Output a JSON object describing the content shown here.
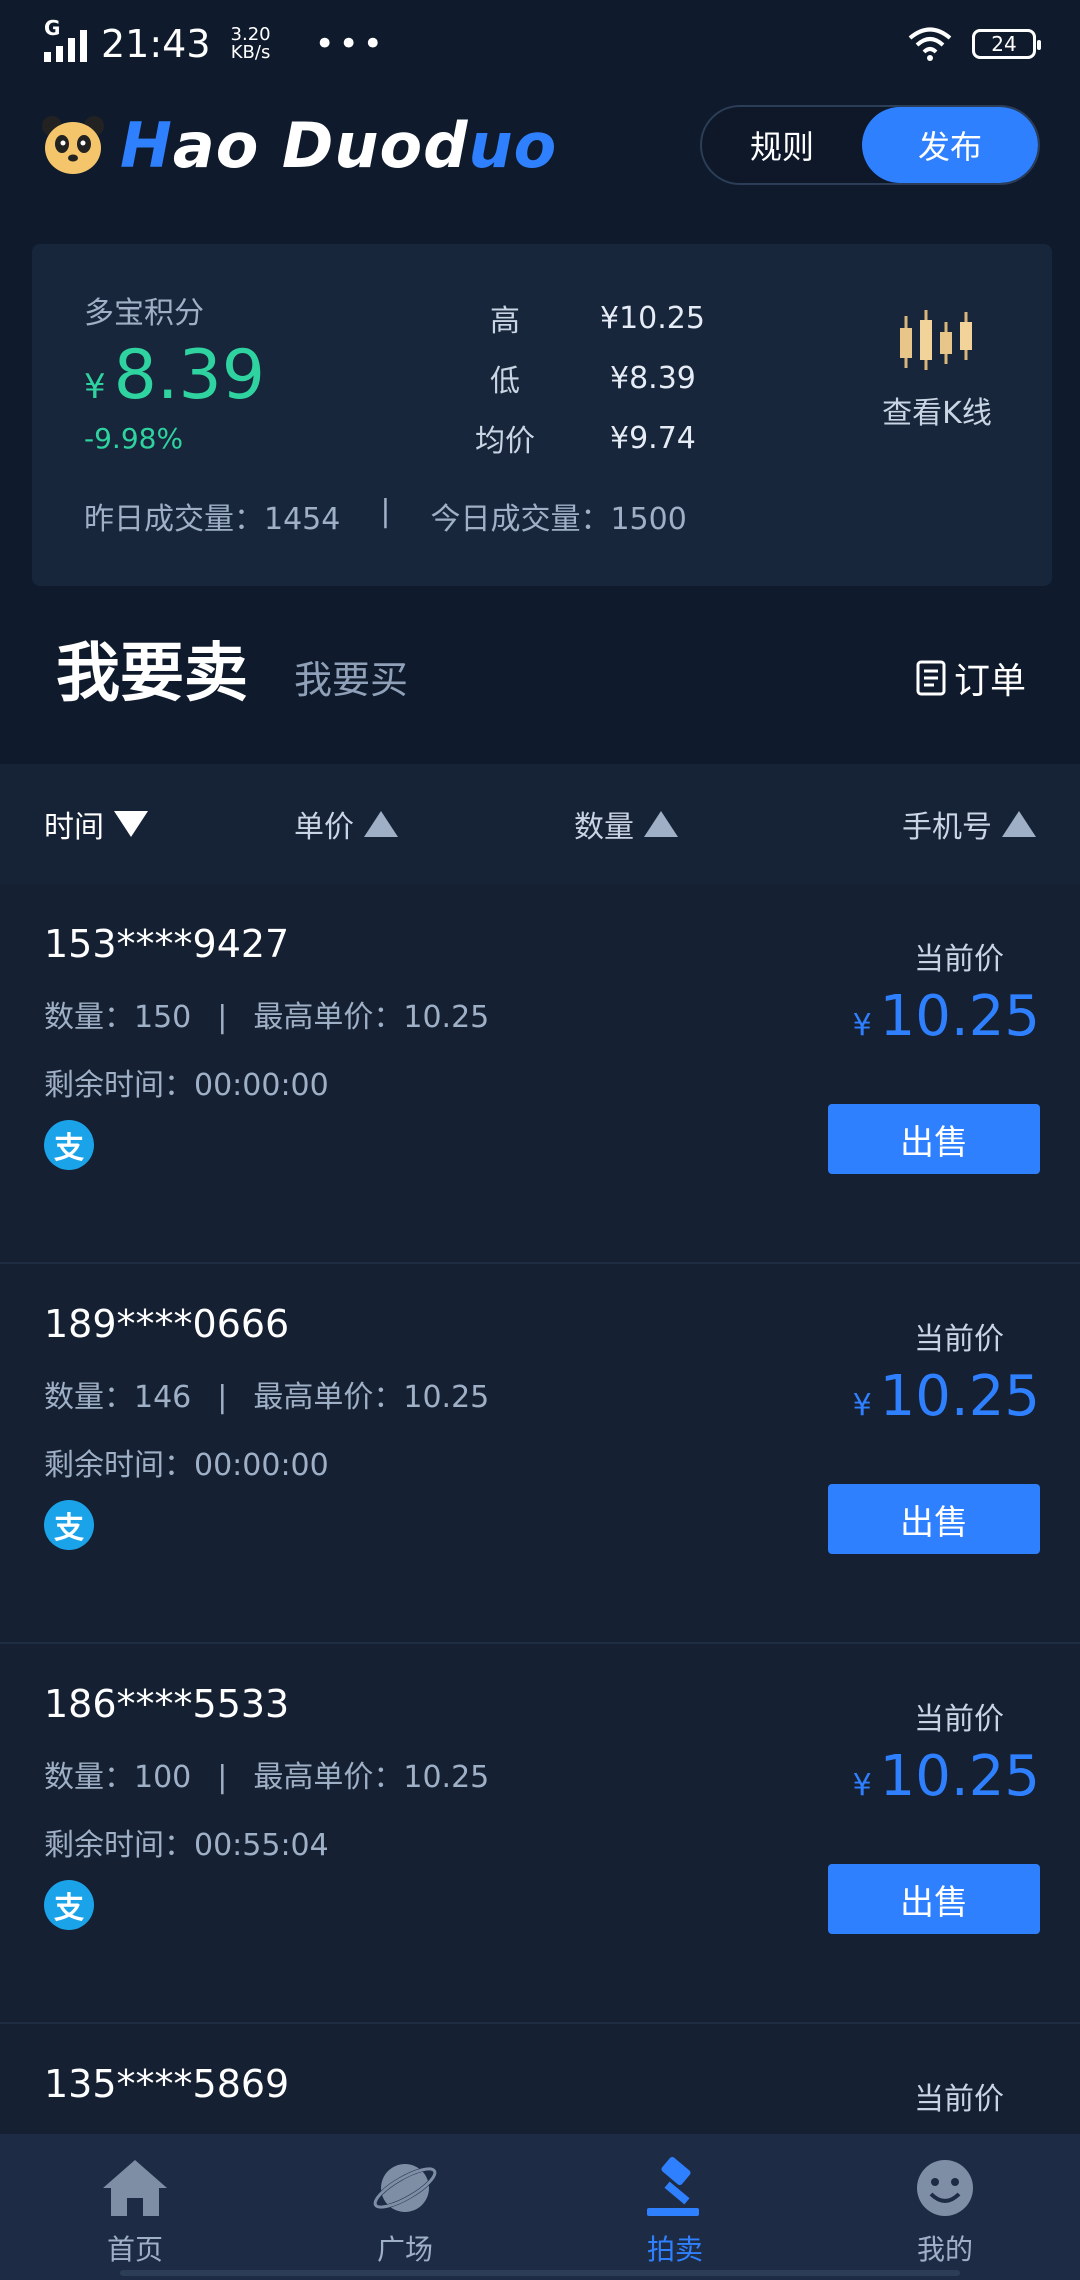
{
  "status_bar": {
    "network": "G",
    "time": "21:43",
    "speed_value": "3.20",
    "speed_unit": "KB/s",
    "more": "•••",
    "battery": "24"
  },
  "header": {
    "brand_h": "H",
    "brand_ao": "ao ",
    "brand_dod": "Duod",
    "brand_uo": "uo",
    "rules_label": "规则",
    "publish_label": "发布"
  },
  "summary": {
    "label": "多宝积分",
    "currency": "¥",
    "price": "8.39",
    "change": "-9.98%",
    "high_label": "高",
    "high_value": "¥10.25",
    "low_label": "低",
    "low_value": "¥8.39",
    "avg_label": "均价",
    "avg_value": "¥9.74",
    "kline_label": "查看K线",
    "yesterday_volume": "昨日成交量：1454",
    "separator": "|",
    "today_volume": "今日成交量：1500"
  },
  "tabs": {
    "sell": "我要卖",
    "buy": "我要买",
    "orders": "订单"
  },
  "sort": {
    "time": "时间",
    "unit_price": "单价",
    "quantity": "数量",
    "phone": "手机号"
  },
  "listings": [
    {
      "phone": "153****9427",
      "quantity": "数量：150",
      "max_price": "最高单价：10.25",
      "remaining": "剩余时间：00:00:00",
      "pay_icon": "支",
      "current_label": "当前价",
      "currency": "¥",
      "current_price": "10.25",
      "action": "出售"
    },
    {
      "phone": "189****0666",
      "quantity": "数量：146",
      "max_price": "最高单价：10.25",
      "remaining": "剩余时间：00:00:00",
      "pay_icon": "支",
      "current_label": "当前价",
      "currency": "¥",
      "current_price": "10.25",
      "action": "出售"
    },
    {
      "phone": "186****5533",
      "quantity": "数量：100",
      "max_price": "最高单价：10.25",
      "remaining": "剩余时间：00:55:04",
      "pay_icon": "支",
      "current_label": "当前价",
      "currency": "¥",
      "current_price": "10.25",
      "action": "出售"
    },
    {
      "phone": "135****5869",
      "current_label": "当前价"
    }
  ],
  "nav": {
    "home": "首页",
    "square": "广场",
    "auction": "拍卖",
    "mine": "我的"
  },
  "colors": {
    "accent": "#2f80ff",
    "positive": "#2fd3a0",
    "background": "#0f1b2c"
  }
}
